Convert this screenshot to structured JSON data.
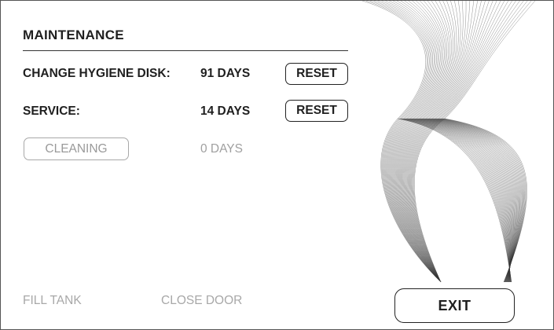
{
  "screen": {
    "title": "MAINTENANCE",
    "rows": [
      {
        "label": "CHANGE HYGIENE DISK:",
        "value": "91 DAYS",
        "button": "RESET"
      },
      {
        "label": "SERVICE:",
        "value": "14 DAYS",
        "button": "RESET"
      }
    ],
    "cleaning": {
      "button": "CLEANING",
      "value": "0 DAYS"
    },
    "footer": {
      "fill_tank": "FILL TANK",
      "close_door": "CLOSE DOOR",
      "exit": "EXIT"
    },
    "colors": {
      "text": "#1f1f1f",
      "disabled": "#a8a8a8",
      "wave": "#333333"
    }
  }
}
